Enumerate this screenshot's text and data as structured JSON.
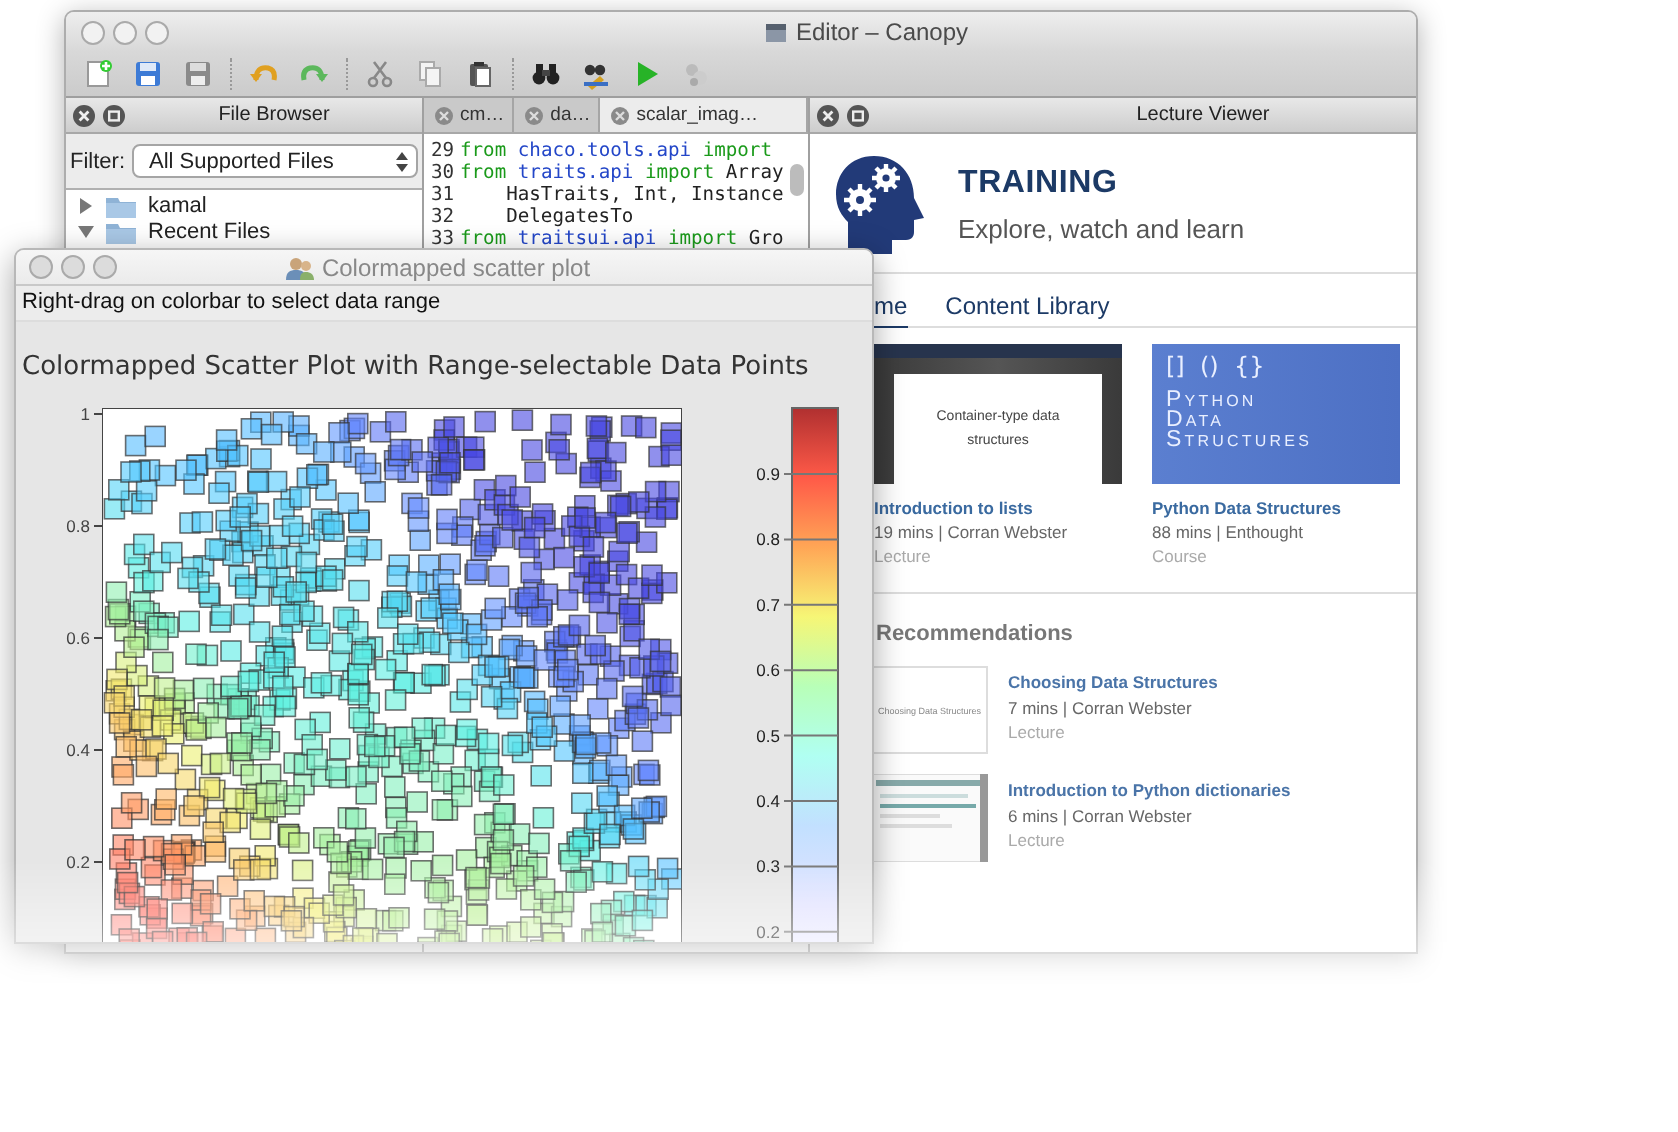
{
  "editor_window": {
    "title": "Editor – Canopy",
    "toolbar_groups": [
      {
        "items": [
          {
            "kind": "new-file"
          },
          {
            "kind": "save"
          },
          {
            "kind": "save-all"
          }
        ]
      },
      {
        "items": [
          {
            "kind": "undo"
          },
          {
            "kind": "redo"
          }
        ]
      },
      {
        "items": [
          {
            "kind": "cut"
          },
          {
            "kind": "copy"
          },
          {
            "kind": "paste"
          }
        ]
      },
      {
        "items": [
          {
            "kind": "find"
          },
          {
            "kind": "find-replace"
          },
          {
            "kind": "run"
          },
          {
            "kind": "debug"
          }
        ]
      }
    ],
    "file_browser": {
      "title": "File Browser",
      "filter_label": "Filter:",
      "filter_value": "All Supported Files",
      "tree": [
        {
          "label": "kamal",
          "expanded": false
        },
        {
          "label": "Recent Files",
          "expanded": true
        }
      ]
    },
    "code_editor": {
      "tabs": [
        {
          "label": "cm…",
          "selected": false
        },
        {
          "label": "da…",
          "selected": false
        },
        {
          "label": "scalar_imag…",
          "selected": true
        }
      ],
      "lines": [
        {
          "number": "29",
          "tokens": [
            {
              "kind": "keyword",
              "text": "from"
            },
            {
              "kind": "module",
              "text": "chaco.tools.api"
            },
            {
              "kind": "keyword",
              "text": "import"
            }
          ]
        },
        {
          "number": "30",
          "tokens": [
            {
              "kind": "keyword",
              "text": "from"
            },
            {
              "kind": "module",
              "text": "traits.api"
            },
            {
              "kind": "keyword",
              "text": "import"
            },
            {
              "kind": "plain",
              "text": "Array"
            }
          ]
        },
        {
          "number": "31",
          "tokens": [
            {
              "kind": "plain",
              "text": "    HasTraits, Int, Instance"
            }
          ]
        },
        {
          "number": "32",
          "tokens": [
            {
              "kind": "plain",
              "text": "    DelegatesTo"
            }
          ]
        },
        {
          "number": "33",
          "tokens": [
            {
              "kind": "keyword",
              "text": "from"
            },
            {
              "kind": "module",
              "text": "traitsui.api"
            },
            {
              "kind": "keyword",
              "text": "import"
            },
            {
              "kind": "plain",
              "text": "Gro"
            }
          ]
        }
      ]
    },
    "lecture_viewer": {
      "title": "Lecture Viewer",
      "banner_title": "TRAINING",
      "banner_subtitle": "Explore, watch and learn",
      "nav": [
        {
          "label": "me",
          "selected": true
        },
        {
          "label": "Content Library",
          "selected": false
        }
      ],
      "cards": [
        {
          "thumbnail": {
            "kind": "slide",
            "text": "Container-type data structures"
          },
          "title": "Introduction to lists",
          "meta": "19 mins | Corran Webster",
          "type": "Lecture"
        },
        {
          "thumbnail": {
            "kind": "cover",
            "symbols": "[]  ()  {}",
            "text": "Python Data Structures"
          },
          "title": "Python Data Structures",
          "meta": "88 mins | Enthought",
          "type": "Course"
        }
      ],
      "recommendations_title": "Recommendations",
      "recommendations": [
        {
          "thumbnail": {
            "kind": "slide",
            "text": "Choosing Data Structures"
          },
          "title": "Choosing Data Structures",
          "meta": "7 mins | Corran Webster",
          "type": "Lecture"
        },
        {
          "thumbnail": {
            "kind": "screenshot"
          },
          "title": "Introduction to Python dictionaries",
          "meta": "6 mins | Corran Webster",
          "type": "Lecture"
        }
      ]
    }
  },
  "scatter_window": {
    "title": "Colormapped scatter plot",
    "hint": "Right-drag on colorbar to select data range",
    "plot_title": "Colormapped Scatter Plot with Range-selectable Data Points",
    "y_ticks": [
      "1",
      "0.8",
      "0.6",
      "0.4",
      "0.2"
    ],
    "colorbar_ticks": [
      "0.9",
      "0.8",
      "0.7",
      "0.6",
      "0.5",
      "0.4",
      "0.3",
      "0.2"
    ]
  }
}
